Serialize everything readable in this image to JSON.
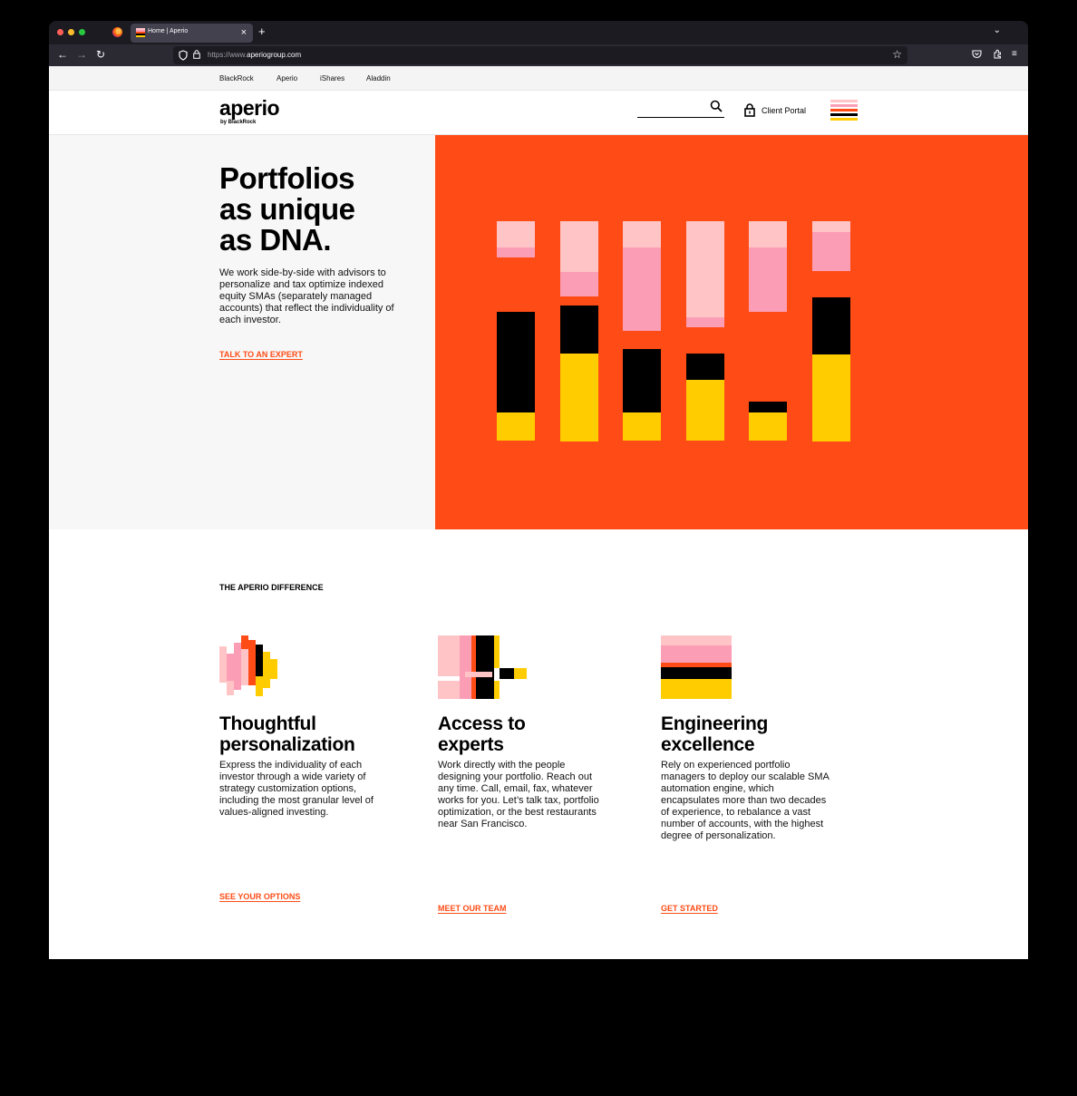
{
  "browser": {
    "tab_title": "Home | Aperio",
    "url_prefix": "https://www.",
    "url_domain": "aperiogroup.com"
  },
  "utility_nav": [
    "BlackRock",
    "Aperio",
    "iShares",
    "Aladdin"
  ],
  "header": {
    "logo": "aperio",
    "logo_sub": "by BlackRock",
    "search_placeholder": "",
    "client_portal_label": "Client Portal"
  },
  "hero": {
    "title_line1": "Portfolios",
    "title_line2": "as unique",
    "title_line3": "as DNA.",
    "body": "We work side-by-side with advisors to personalize and tax optimize indexed equity SMAs (separately managed accounts) that reflect the individuality of each investor.",
    "cta": "TALK TO AN EXPERT"
  },
  "difference": {
    "heading": "THE APERIO DIFFERENCE",
    "features": [
      {
        "title_line1": "Thoughtful",
        "title_line2": "personalization",
        "body": "Express the individuality of each investor through a wide variety of strategy customization options, including the most granular level of values-aligned investing.",
        "cta": "SEE YOUR OPTIONS"
      },
      {
        "title_line1": "Access to",
        "title_line2": "experts",
        "body": "Work directly with the people designing your portfolio. Reach out any time. Call, email, fax, whatever works for you. Let’s talk tax, portfolio optimization, or the best restaurants near San Francisco.",
        "cta": "MEET OUR TEAM"
      },
      {
        "title_line1": "Engineering",
        "title_line2": "excellence",
        "body": "Rely on experienced portfolio managers to deploy our scalable SMA automation engine, which encapsulates more than two decades of experience, to rebalance a vast number of accounts, with the highest degree of personalization.",
        "cta": "GET STARTED"
      }
    ]
  },
  "colors": {
    "orange": "#ff4c16",
    "light_pink": "#ffc4c6",
    "pink": "#fb9db4",
    "black": "#000000",
    "yellow": "#ffcc00"
  }
}
